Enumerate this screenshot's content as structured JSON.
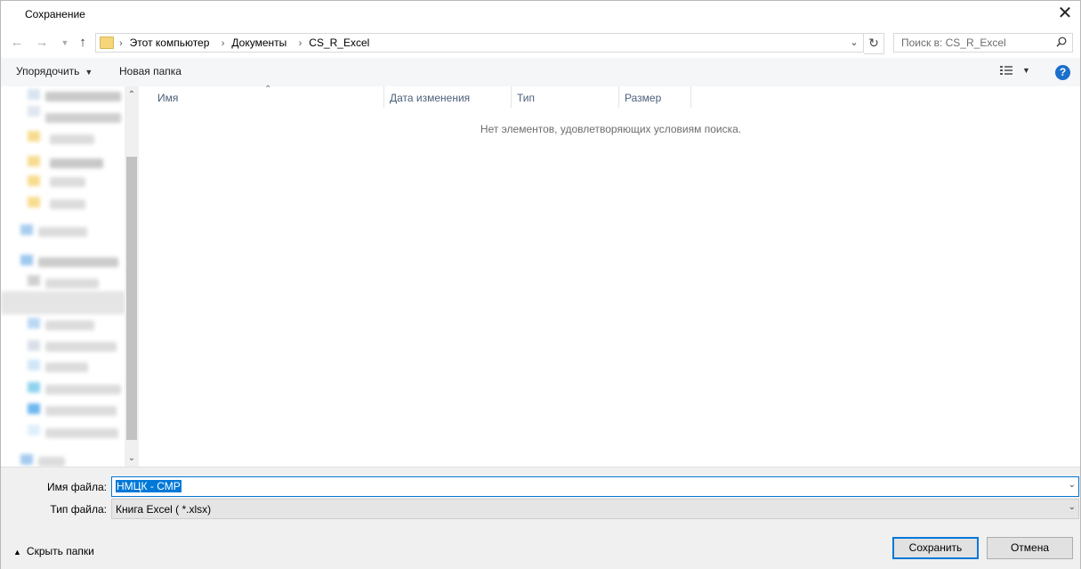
{
  "window": {
    "title": "Сохранение"
  },
  "address": {
    "breadcrumbs": [
      "Этот компьютер",
      "Документы",
      "CS_R_Excel"
    ]
  },
  "search": {
    "placeholder": "Поиск в: CS_R_Excel"
  },
  "toolbar": {
    "organize_label": "Упорядочить",
    "new_folder_label": "Новая папка"
  },
  "columns": [
    "Имя",
    "Дата изменения",
    "Тип",
    "Размер"
  ],
  "list": {
    "empty_message": "Нет элементов, удовлетворяющих условиям поиска."
  },
  "form": {
    "filename_label": "Имя файла:",
    "filename_value": "НМЦК - СМР",
    "filetype_label": "Тип файла:",
    "filetype_value": "Книга Excel ( *.xlsx)"
  },
  "footer": {
    "hide_folders_label": "Скрыть папки",
    "save_label": "Сохранить",
    "cancel_label": "Отмена"
  },
  "colors": {
    "accent": "#0078d7",
    "help": "#1c6fcb",
    "header_text": "#4c607a"
  }
}
